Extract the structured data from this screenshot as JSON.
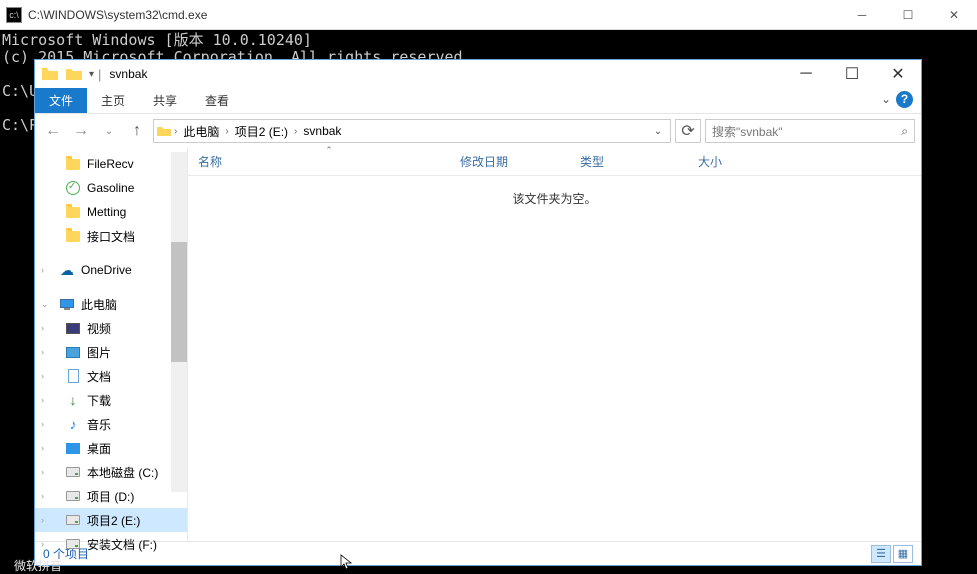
{
  "cmd": {
    "title": "C:\\WINDOWS\\system32\\cmd.exe",
    "lines": "Microsoft Windows [版本 10.0.10240]\n(c) 2015 Microsoft Corporation. All rights reserved.\n\nC:\\Users>\n\nC:\\P"
  },
  "explorer": {
    "title": "svnbak",
    "ribbon": {
      "file": "文件",
      "home": "主页",
      "share": "共享",
      "view": "查看"
    },
    "breadcrumb": {
      "b0": "此电脑",
      "b1": "项目2 (E:)",
      "b2": "svnbak"
    },
    "search_placeholder": "搜索\"svnbak\"",
    "sidebar": {
      "filerecv": "FileRecv",
      "gasoline": "Gasoline",
      "metting": "Metting",
      "jiekou": "接口文档",
      "onedrive": "OneDrive",
      "thispc": "此电脑",
      "video": "视频",
      "pic": "图片",
      "doc": "文档",
      "download": "下载",
      "music": "音乐",
      "desktop": "桌面",
      "cdrive": "本地磁盘 (C:)",
      "ddrive": "项目 (D:)",
      "edrive": "项目2 (E:)",
      "fdrive": "安装文档 (F:)"
    },
    "columns": {
      "name": "名称",
      "date": "修改日期",
      "type": "类型",
      "size": "大小"
    },
    "empty_msg": "该文件夹为空。",
    "status": "0 个项目"
  },
  "taskbar_peek": "微软拼音"
}
